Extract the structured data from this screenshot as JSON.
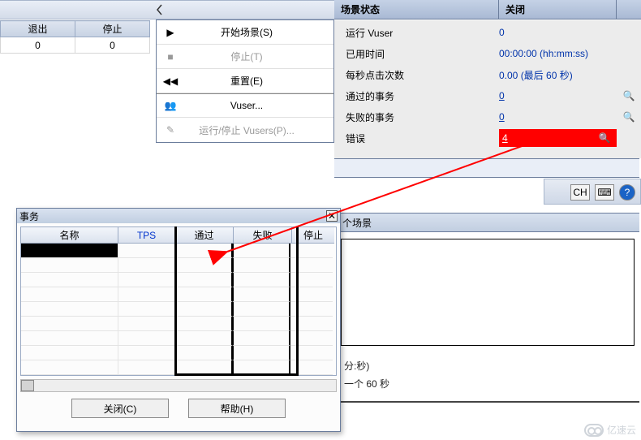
{
  "top_table": {
    "headers": [
      "退出",
      "停止"
    ],
    "values": [
      "0",
      "0"
    ]
  },
  "actions": {
    "start": {
      "label": "开始场景(S)",
      "enabled": true
    },
    "stop": {
      "label": "停止(T)",
      "enabled": false
    },
    "reset": {
      "label": "重置(E)",
      "enabled": true
    },
    "vuser": {
      "label": "Vuser...",
      "enabled": true
    },
    "runstop": {
      "label": "运行/停止 Vusers(P)...",
      "enabled": false
    }
  },
  "status_panel": {
    "title": "场景状态",
    "close_header": "关闭",
    "rows": {
      "running_vuser": {
        "label": "运行 Vuser",
        "value": "0",
        "link": false,
        "icon": ""
      },
      "elapsed": {
        "label": "已用时间",
        "value": "00:00:00 (hh:mm:ss)",
        "link": false,
        "icon": ""
      },
      "tps": {
        "label": "每秒点击次数",
        "value": "0.00 (最后 60 秒)",
        "link": false,
        "icon": ""
      },
      "passed_tx": {
        "label": "通过的事务",
        "value": "0",
        "link": true,
        "icon": "🔍"
      },
      "failed_tx": {
        "label": "失败的事务",
        "value": "0",
        "link": true,
        "icon": "🔍"
      },
      "errors": {
        "label": "错误",
        "value": "4",
        "link": true,
        "icon": "🔍",
        "highlight": true
      }
    }
  },
  "statusbar": {
    "ch": "CH"
  },
  "right_section": {
    "title_suffix": "个场景",
    "line1": "分:秒)",
    "line2": "一个 60 秒"
  },
  "tx_dialog": {
    "title": "事务",
    "columns": {
      "name": "名称",
      "tps": "TPS",
      "pass": "通过",
      "fail": "失败",
      "stop": "停止"
    },
    "rows": [
      {
        "name": "",
        "tps": "",
        "pass": "",
        "fail": "",
        "stop": ""
      }
    ],
    "close_btn": "关闭(C)",
    "help_btn": "帮助(H)"
  },
  "watermark": "亿速云"
}
